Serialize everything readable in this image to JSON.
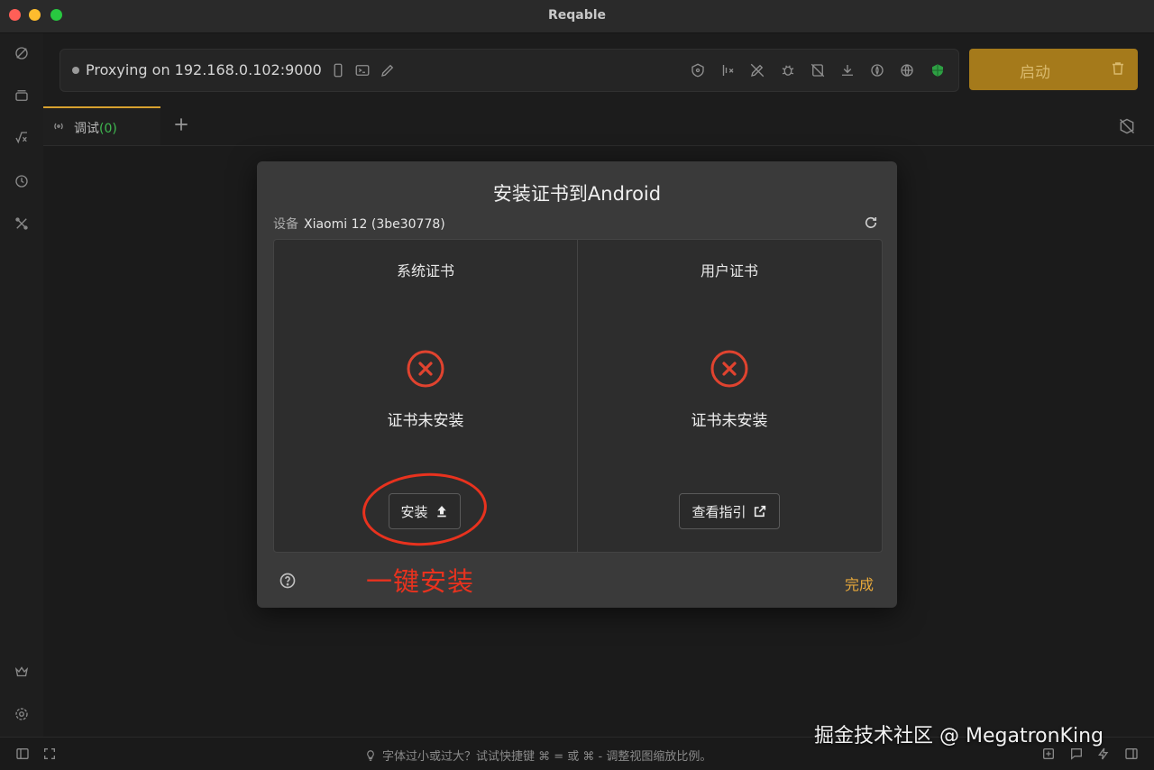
{
  "window": {
    "title": "Reqable"
  },
  "toolbar": {
    "proxy_status": "Proxying on 192.168.0.102:9000",
    "start_label": "启动"
  },
  "tabs": [
    {
      "label": "调试",
      "count": "(0)"
    }
  ],
  "dialog": {
    "title": "安装证书到Android",
    "device_label": "设备",
    "device_name": "Xiaomi 12 (3be30778)",
    "system_cert": {
      "title": "系统证书",
      "status": "证书未安装",
      "action": "安装"
    },
    "user_cert": {
      "title": "用户证书",
      "status": "证书未安装",
      "action": "查看指引"
    },
    "done_label": "完成"
  },
  "annotation": {
    "text": "一键安装",
    "color": "#e8321e"
  },
  "statusbar": {
    "hint": "字体过小或过大？试试快捷键  ⌘  =  或  ⌘  -  调整视图缩放比例。"
  },
  "watermark": "掘金技术社区 @ MegatronKing",
  "colors": {
    "accent": "#a57a1b",
    "done": "#e8a93a",
    "error": "#e0432f",
    "success": "#3fb950"
  }
}
